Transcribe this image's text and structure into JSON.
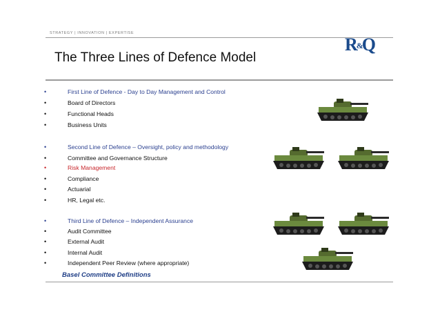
{
  "header": {
    "tagline": "STRATEGY  |  INNOVATION  |  EXPERTISE",
    "logo_left": "R",
    "logo_amp": "&",
    "logo_right": "Q"
  },
  "title": "The Three Lines of Defence Model",
  "bullets": [
    {
      "text": "First Line of Defence - Day to Day Management and Control",
      "style": "blue"
    },
    {
      "text": "Board of Directors",
      "style": "normal"
    },
    {
      "text": "Functional Heads",
      "style": "normal"
    },
    {
      "text": "Business Units",
      "style": "normal"
    },
    {
      "text": "Second Line of Defence – Oversight, policy and methodology",
      "style": "blue"
    },
    {
      "text": "Committee and Governance Structure",
      "style": "normal"
    },
    {
      "text": "Risk Management",
      "style": "red"
    },
    {
      "text": "Compliance",
      "style": "normal"
    },
    {
      "text": "Actuarial",
      "style": "normal"
    },
    {
      "text": "HR, Legal etc.",
      "style": "normal"
    },
    {
      "text": "Third Line of Defence – Independent Assurance",
      "style": "blue"
    },
    {
      "text": "Audit Committee",
      "style": "normal"
    },
    {
      "text": "External Audit",
      "style": "normal"
    },
    {
      "text": "Internal Audit",
      "style": "normal"
    },
    {
      "text": "Independent Peer Review (where appropriate)",
      "style": "normal"
    }
  ],
  "footer_note": "Basel Committee Definitions",
  "colors": {
    "heading_blue": "#2a3f8f",
    "risk_red": "#c8262b",
    "logo_blue": "#1b4b8c",
    "tank_green": "#5f7a3a"
  },
  "icons": [
    "tank-icon"
  ]
}
